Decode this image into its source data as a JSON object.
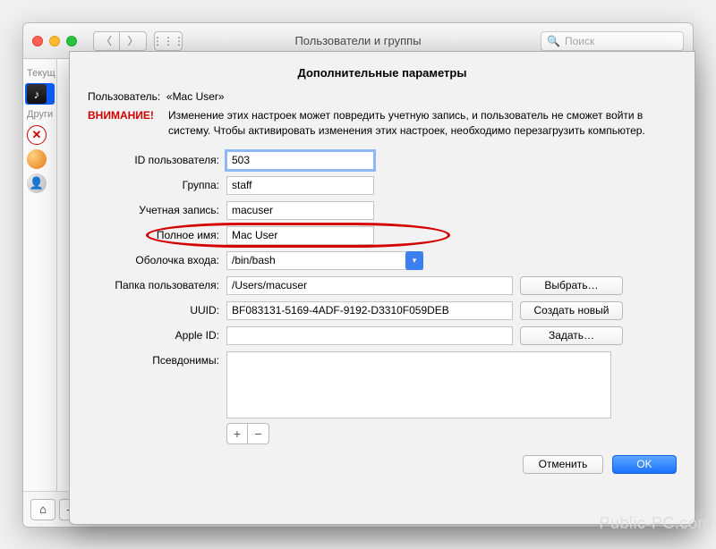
{
  "window": {
    "title": "Пользователи и группы",
    "searchPlaceholder": "Поиск"
  },
  "sidebar": {
    "label1": "Текущ",
    "label2": "Други"
  },
  "modal": {
    "title": "Дополнительные параметры",
    "userLabel": "Пользователь:",
    "userName": "«Mac User»",
    "warnLabel": "ВНИМАНИЕ!",
    "warnText": "Изменение этих настроек может повредить учетную запись, и пользователь не сможет войти в систему. Чтобы активировать изменения этих настроек, необходимо перезагрузить компьютер.",
    "fields": {
      "userIdLabel": "ID пользователя:",
      "userIdValue": "503",
      "groupLabel": "Группа:",
      "groupValue": "staff",
      "accountLabel": "Учетная запись:",
      "accountValue": "macuser",
      "fullnameLabel": "Полное имя:",
      "fullnameValue": "Mac User",
      "shellLabel": "Оболочка входа:",
      "shellValue": "/bin/bash",
      "homeLabel": "Папка пользователя:",
      "homeValue": "/Users/macuser",
      "homeBtn": "Выбрать…",
      "uuidLabel": "UUID:",
      "uuidValue": "BF083131-5169-4ADF-9192-D3310F059DEB",
      "uuidBtn": "Создать новый",
      "appleIdLabel": "Apple ID:",
      "appleIdValue": "",
      "appleIdBtn": "Задать…",
      "aliasesLabel": "Псевдонимы:"
    },
    "cancel": "Отменить",
    "ok": "OK"
  },
  "watermark": "Public-PC.com"
}
